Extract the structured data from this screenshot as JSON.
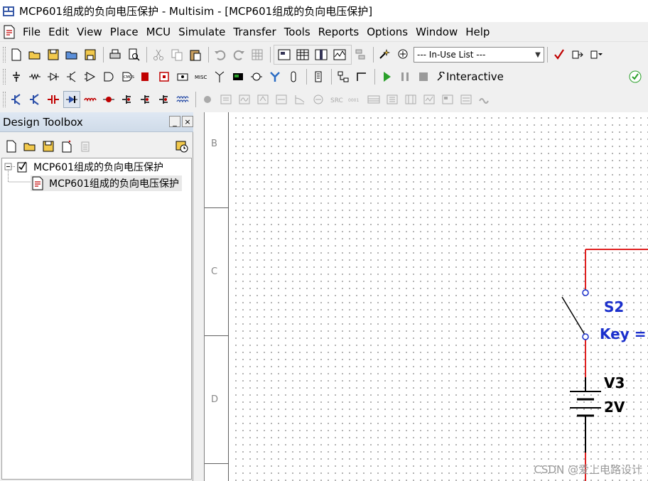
{
  "window": {
    "title": "MCP601组成的负向电压保护 - Multisim - [MCP601组成的负向电压保护]"
  },
  "menu": {
    "items": [
      {
        "label": "File",
        "name": "menu-file"
      },
      {
        "label": "Edit",
        "name": "menu-edit"
      },
      {
        "label": "View",
        "name": "menu-view"
      },
      {
        "label": "Place",
        "name": "menu-place"
      },
      {
        "label": "MCU",
        "name": "menu-mcu"
      },
      {
        "label": "Simulate",
        "name": "menu-simulate"
      },
      {
        "label": "Transfer",
        "name": "menu-transfer"
      },
      {
        "label": "Tools",
        "name": "menu-tools"
      },
      {
        "label": "Reports",
        "name": "menu-reports"
      },
      {
        "label": "Options",
        "name": "menu-options"
      },
      {
        "label": "Window",
        "name": "menu-window"
      },
      {
        "label": "Help",
        "name": "menu-help"
      }
    ]
  },
  "toolbar": {
    "in_use_list": "--- In-Use List ---",
    "interactive_label": "Interactive"
  },
  "toolbox": {
    "title": "Design Toolbox",
    "minimize_label": "_",
    "close_label": "×",
    "tree": {
      "project": "MCP601组成的负向电压保护",
      "sheet": "MCP601组成的负向电压保护"
    }
  },
  "schematic": {
    "zones": [
      "B",
      "C",
      "D"
    ],
    "switch_ref": "S2",
    "switch_key": "Key =",
    "battery_ref": "V3",
    "battery_value": "2V",
    "colors": {
      "wire": "#e02020",
      "label": "#1a2fcc",
      "component": "#000000",
      "pin": "#1a2fcc"
    }
  },
  "watermark": "CSDN @爱上电路设计"
}
